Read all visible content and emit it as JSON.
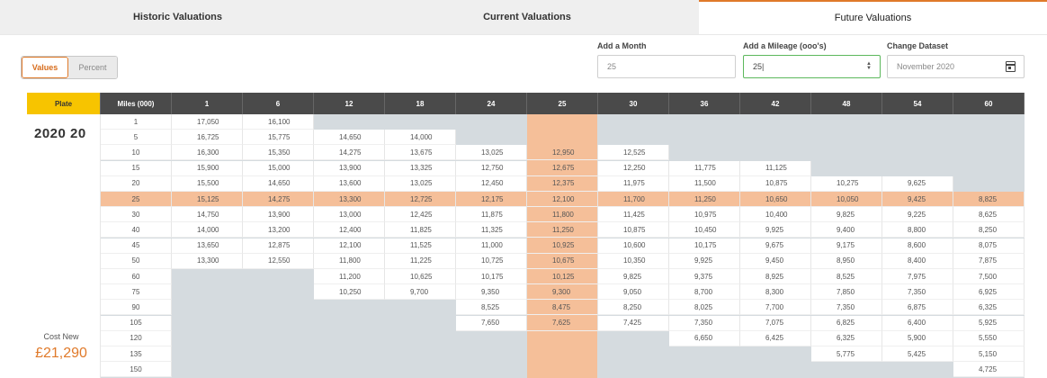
{
  "tabs": [
    "Historic Valuations",
    "Current Valuations",
    "Future Valuations"
  ],
  "toggle": {
    "values": "Values",
    "percent": "Percent"
  },
  "controls": {
    "month_label": "Add a Month",
    "month_value": "25",
    "mileage_label": "Add a Mileage (ooo's)",
    "mileage_value": "25|",
    "dataset_label": "Change Dataset",
    "dataset_value": "November 2020"
  },
  "table": {
    "plate_header": "Plate",
    "miles_header": "Miles (000)",
    "plate": "2020 20",
    "cost_label": "Cost New",
    "cost_value": "£21,290",
    "months": [
      "1",
      "6",
      "12",
      "18",
      "24",
      "25",
      "30",
      "36",
      "42",
      "48",
      "54",
      "60"
    ],
    "miles": [
      "1",
      "5",
      "10",
      "15",
      "20",
      "25",
      "30",
      "40",
      "45",
      "50",
      "60",
      "75",
      "90",
      "105",
      "120",
      "135",
      "150"
    ],
    "highlight_month": "25",
    "highlight_mile": "25",
    "rows": [
      [
        "17,050",
        "16,100",
        "",
        "",
        "",
        "",
        "",
        "",
        "",
        "",
        "",
        ""
      ],
      [
        "16,725",
        "15,775",
        "14,650",
        "14,000",
        "",
        "",
        "",
        "",
        "",
        "",
        "",
        ""
      ],
      [
        "16,300",
        "15,350",
        "14,275",
        "13,675",
        "13,025",
        "12,950",
        "12,525",
        "",
        "",
        "",
        "",
        ""
      ],
      [
        "15,900",
        "15,000",
        "13,900",
        "13,325",
        "12,750",
        "12,675",
        "12,250",
        "11,775",
        "11,125",
        "",
        "",
        ""
      ],
      [
        "15,500",
        "14,650",
        "13,600",
        "13,025",
        "12,450",
        "12,375",
        "11,975",
        "11,500",
        "10,875",
        "10,275",
        "9,625",
        ""
      ],
      [
        "15,125",
        "14,275",
        "13,300",
        "12,725",
        "12,175",
        "12,100",
        "11,700",
        "11,250",
        "10,650",
        "10,050",
        "9,425",
        "8,825"
      ],
      [
        "14,750",
        "13,900",
        "13,000",
        "12,425",
        "11,875",
        "11,800",
        "11,425",
        "10,975",
        "10,400",
        "9,825",
        "9,225",
        "8,625"
      ],
      [
        "14,000",
        "13,200",
        "12,400",
        "11,825",
        "11,325",
        "11,250",
        "10,875",
        "10,450",
        "9,925",
        "9,400",
        "8,800",
        "8,250"
      ],
      [
        "13,650",
        "12,875",
        "12,100",
        "11,525",
        "11,000",
        "10,925",
        "10,600",
        "10,175",
        "9,675",
        "9,175",
        "8,600",
        "8,075"
      ],
      [
        "13,300",
        "12,550",
        "11,800",
        "11,225",
        "10,725",
        "10,675",
        "10,350",
        "9,925",
        "9,450",
        "8,950",
        "8,400",
        "7,875"
      ],
      [
        "",
        "",
        "11,200",
        "10,625",
        "10,175",
        "10,125",
        "9,825",
        "9,375",
        "8,925",
        "8,525",
        "7,975",
        "7,500"
      ],
      [
        "",
        "",
        "10,250",
        "9,700",
        "9,350",
        "9,300",
        "9,050",
        "8,700",
        "8,300",
        "7,850",
        "7,350",
        "6,925"
      ],
      [
        "",
        "",
        "",
        "",
        "8,525",
        "8,475",
        "8,250",
        "8,025",
        "7,700",
        "7,350",
        "6,875",
        "6,325"
      ],
      [
        "",
        "",
        "",
        "",
        "7,650",
        "7,625",
        "7,425",
        "7,350",
        "7,075",
        "6,825",
        "6,400",
        "5,925"
      ],
      [
        "",
        "",
        "",
        "",
        "",
        "",
        "",
        "6,650",
        "6,425",
        "6,325",
        "5,900",
        "5,550"
      ],
      [
        "",
        "",
        "",
        "",
        "",
        "",
        "",
        "",
        "",
        "5,775",
        "5,425",
        "5,150"
      ],
      [
        "",
        "",
        "",
        "",
        "",
        "",
        "",
        "",
        "",
        "",
        "",
        "4,725"
      ]
    ]
  },
  "colors": {
    "accent": "#e07a2a",
    "highlight": "#f5bf99",
    "plate_header": "#f7c400",
    "header": "#4a4a4a",
    "empty": "#d5dbdf"
  }
}
